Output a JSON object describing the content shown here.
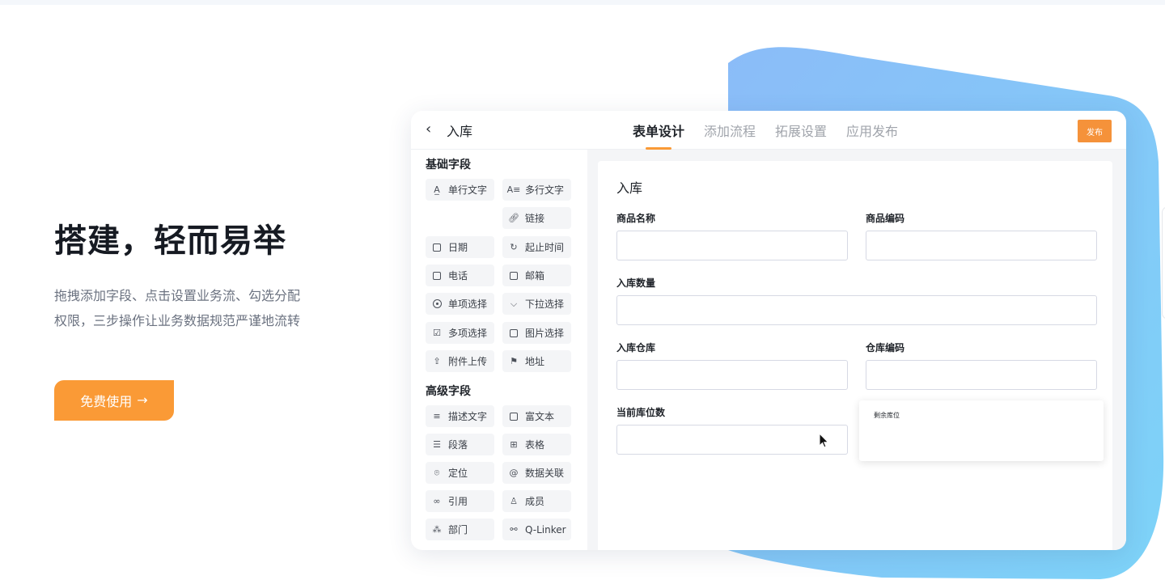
{
  "hero": {
    "title": "搭建，轻而易举",
    "desc_line1": "拖拽添加字段、点击设置业务流、勾选分配",
    "desc_line2": "权限，三步操作让业务数据规范严谨地流转",
    "cta_label": "免费使用",
    "cta_icon": "arrow-right-icon"
  },
  "app": {
    "back_icon": "chevron-left-icon",
    "title": "入库",
    "tabs": [
      {
        "label": "表单设计",
        "active": true
      },
      {
        "label": "添加流程",
        "active": false
      },
      {
        "label": "拓展设置",
        "active": false
      },
      {
        "label": "应用发布",
        "active": false
      }
    ],
    "publish_label": "发布",
    "accent_color": "#fa9a36"
  },
  "palette": {
    "basic_title": "基础字段",
    "basic": [
      {
        "label": "单行文字",
        "icon": "text-single-icon"
      },
      {
        "label": "多行文字",
        "icon": "text-multi-icon"
      },
      {
        "label": "链接",
        "icon": "link-icon"
      },
      {
        "label": "日期",
        "icon": "calendar-icon"
      },
      {
        "label": "起止时间",
        "icon": "time-range-icon"
      },
      {
        "label": "电话",
        "icon": "phone-icon"
      },
      {
        "label": "邮箱",
        "icon": "mail-icon"
      },
      {
        "label": "单项选择",
        "icon": "radio-icon"
      },
      {
        "label": "下拉选择",
        "icon": "dropdown-icon"
      },
      {
        "label": "多项选择",
        "icon": "checkbox-icon"
      },
      {
        "label": "图片选择",
        "icon": "image-icon"
      },
      {
        "label": "附件上传",
        "icon": "upload-icon"
      },
      {
        "label": "地址",
        "icon": "address-icon"
      }
    ],
    "advanced_title": "高级字段",
    "advanced": [
      {
        "label": "描述文字",
        "icon": "description-icon"
      },
      {
        "label": "富文本",
        "icon": "rich-text-icon"
      },
      {
        "label": "段落",
        "icon": "paragraph-icon"
      },
      {
        "label": "表格",
        "icon": "table-icon"
      },
      {
        "label": "定位",
        "icon": "location-icon"
      },
      {
        "label": "数据关联",
        "icon": "data-link-icon"
      },
      {
        "label": "引用",
        "icon": "reference-icon"
      },
      {
        "label": "成员",
        "icon": "member-icon"
      },
      {
        "label": "部门",
        "icon": "department-icon"
      },
      {
        "label": "Q-Linker",
        "icon": "qlinker-icon"
      }
    ]
  },
  "form": {
    "title": "入库",
    "fields": [
      {
        "label": "商品名称",
        "value": ""
      },
      {
        "label": "商品编码",
        "value": ""
      },
      {
        "label": "入库数量",
        "value": ""
      },
      {
        "label": "入库仓库",
        "value": ""
      },
      {
        "label": "仓库编码",
        "value": ""
      },
      {
        "label": "当前库位数",
        "value": ""
      }
    ],
    "dragging_label": "剩余库位"
  }
}
